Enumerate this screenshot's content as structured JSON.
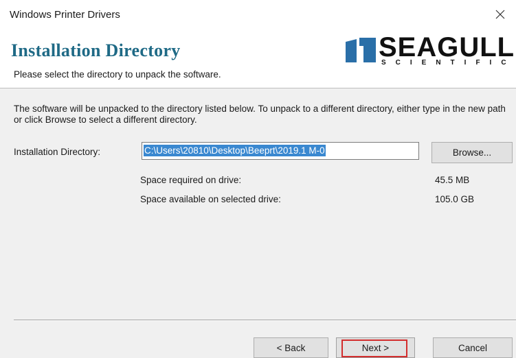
{
  "window": {
    "title": "Windows Printer Drivers"
  },
  "header": {
    "title": "Installation Directory",
    "subtitle": "Please select the directory to unpack the software."
  },
  "logo": {
    "name": "SEAGULL",
    "subtitle": "SCIENTIFIC",
    "color": "#2a6fa8"
  },
  "main": {
    "description": "The software will be unpacked to the directory listed below.  To unpack to a different directory, either type in the new path or click Browse to select a different directory.",
    "dir_label": "Installation Directory:",
    "dir_value": "C:\\Users\\20810\\Desktop\\Beeprt\\2019.1 M-0",
    "browse_label": "Browse...",
    "space_required_label": "Space required on drive:",
    "space_required_value": "45.5 MB",
    "space_available_label": "Space available on selected drive:",
    "space_available_value": "105.0 GB"
  },
  "footer": {
    "back_label": "< Back",
    "next_label": "Next >",
    "cancel_label": "Cancel"
  },
  "colors": {
    "header_title": "#1f6a86",
    "selection": "#3a88d0",
    "focus_highlight": "#d32c2c"
  }
}
